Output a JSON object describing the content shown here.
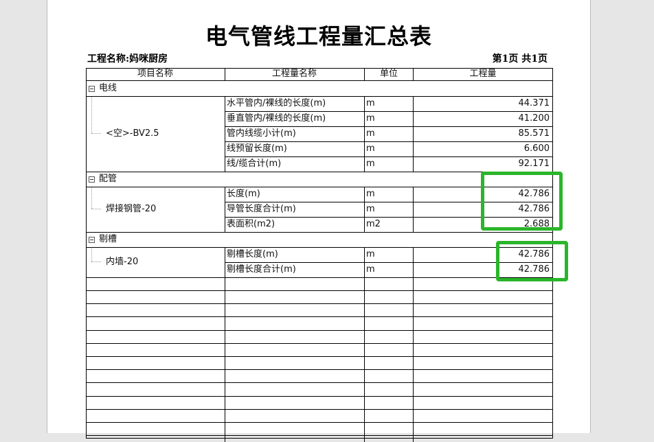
{
  "title": "电气管线工程量汇总表",
  "project_label": "工程名称:妈咪厨房",
  "page_info": "第1页  共1页",
  "columns": [
    "项目名称",
    "工程量名称",
    "单位",
    "工程量"
  ],
  "groups": [
    {
      "name": "电线",
      "item": "<空>-BV2.5",
      "rows": [
        {
          "name": "水平管内/裸线的长度(m)",
          "unit": "m",
          "value": "44.371"
        },
        {
          "name": "垂直管内/裸线的长度(m)",
          "unit": "m",
          "value": "41.200"
        },
        {
          "name": "管内线缆小计(m)",
          "unit": "m",
          "value": "85.571"
        },
        {
          "name": "线预留长度(m)",
          "unit": "m",
          "value": "6.600"
        },
        {
          "name": "线/缆合计(m)",
          "unit": "m",
          "value": "92.171"
        }
      ]
    },
    {
      "name": "配管",
      "item": "焊接钢管-20",
      "rows": [
        {
          "name": "长度(m)",
          "unit": "m",
          "value": "42.786"
        },
        {
          "name": "导管长度合计(m)",
          "unit": "m",
          "value": "42.786"
        },
        {
          "name": "表面积(m2)",
          "unit": "m2",
          "value": "2.688"
        }
      ]
    },
    {
      "name": "剔槽",
      "item": "内墙-20",
      "rows": [
        {
          "name": "剔槽长度(m)",
          "unit": "m",
          "value": "42.786"
        },
        {
          "name": "剔槽长度合计(m)",
          "unit": "m",
          "value": "42.786"
        }
      ]
    }
  ],
  "highlight_color": "#2ab52a"
}
